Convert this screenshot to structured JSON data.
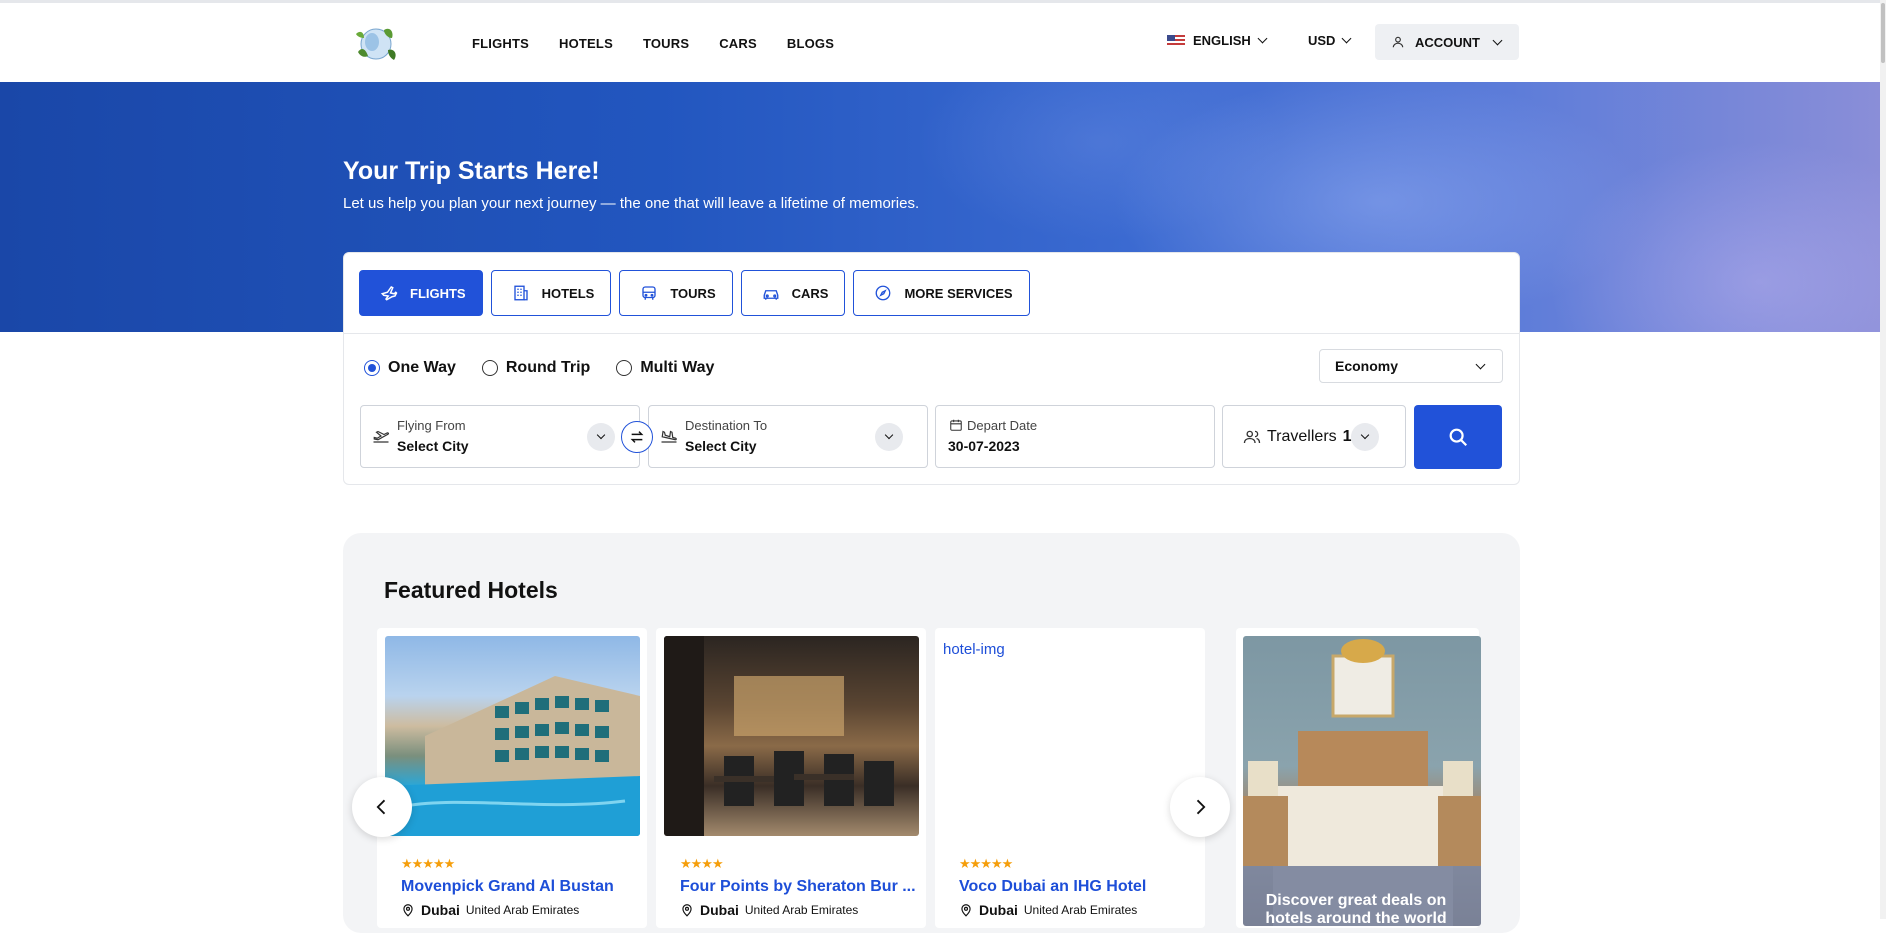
{
  "header": {
    "nav": [
      "FLIGHTS",
      "HOTELS",
      "TOURS",
      "CARS",
      "BLOGS"
    ],
    "language": "ENGLISH",
    "currency": "USD",
    "account": "ACCOUNT"
  },
  "hero": {
    "title": "Your Trip Starts Here!",
    "subtitle": "Let us help you plan your next journey — the one that will leave a lifetime of memories."
  },
  "search": {
    "tabs": [
      {
        "label": "FLIGHTS",
        "icon": "plane-icon",
        "active": true
      },
      {
        "label": "HOTELS",
        "icon": "building-icon",
        "active": false
      },
      {
        "label": "TOURS",
        "icon": "bus-icon",
        "active": false
      },
      {
        "label": "CARS",
        "icon": "car-icon",
        "active": false
      },
      {
        "label": "MORE SERVICES",
        "icon": "compass-icon",
        "active": false
      }
    ],
    "trip_types": [
      "One Way",
      "Round Trip",
      "Multi Way"
    ],
    "selected_trip": "One Way",
    "cabin_class": "Economy",
    "from": {
      "label": "Flying From",
      "value": "Select City"
    },
    "to": {
      "label": "Destination To",
      "value": "Select City"
    },
    "depart": {
      "label": "Depart Date",
      "value": "30-07-2023"
    },
    "travellers": {
      "label": "Travellers",
      "count": "1"
    }
  },
  "featured": {
    "title": "Featured Hotels",
    "hotels": [
      {
        "name": "Movenpick Grand Al Bustan",
        "stars": "★★★★★",
        "city": "Dubai",
        "country": "United Arab Emirates"
      },
      {
        "name": "Four Points by Sheraton Bur ...",
        "stars": "★★★★",
        "city": "Dubai",
        "country": "United Arab Emirates"
      },
      {
        "name": "Voco Dubai an IHG Hotel",
        "stars": "★★★★★",
        "city": "Dubai",
        "country": "United Arab Emirates",
        "image_alt": "hotel-img"
      }
    ],
    "promo": "Discover great deals on hotels around the world"
  },
  "colors": {
    "accent": "#2152d9",
    "link": "#1d4ed8",
    "star": "#f59e0b"
  }
}
